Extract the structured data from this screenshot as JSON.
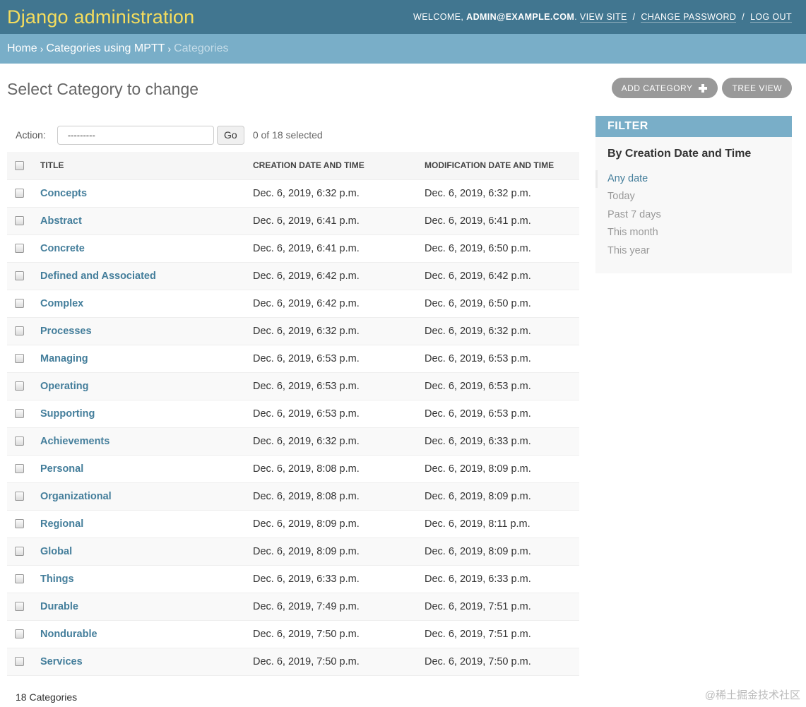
{
  "header": {
    "branding": "Django administration",
    "welcome": "WELCOME,",
    "user": "ADMIN@EXAMPLE.COM",
    "view_site": "VIEW SITE",
    "change_password": "CHANGE PASSWORD",
    "log_out": "LOG OUT"
  },
  "breadcrumbs": {
    "home": "Home",
    "app": "Categories using MPTT",
    "current": "Categories"
  },
  "page_title": "Select Category to change",
  "tools": {
    "add_label": "ADD CATEGORY",
    "tree_label": "TREE VIEW"
  },
  "actions": {
    "label": "Action:",
    "select_value": "---------",
    "go_label": "Go",
    "selected_text": "0 of 18 selected"
  },
  "table": {
    "headers": {
      "title": "TITLE",
      "created": "CREATION DATE AND TIME",
      "modified": "MODIFICATION DATE AND TIME"
    },
    "rows": [
      {
        "title": "Concepts",
        "created": "Dec. 6, 2019, 6:32 p.m.",
        "modified": "Dec. 6, 2019, 6:32 p.m."
      },
      {
        "title": "Abstract",
        "created": "Dec. 6, 2019, 6:41 p.m.",
        "modified": "Dec. 6, 2019, 6:41 p.m."
      },
      {
        "title": "Concrete",
        "created": "Dec. 6, 2019, 6:41 p.m.",
        "modified": "Dec. 6, 2019, 6:50 p.m."
      },
      {
        "title": "Defined and Associated",
        "created": "Dec. 6, 2019, 6:42 p.m.",
        "modified": "Dec. 6, 2019, 6:42 p.m."
      },
      {
        "title": "Complex",
        "created": "Dec. 6, 2019, 6:42 p.m.",
        "modified": "Dec. 6, 2019, 6:50 p.m."
      },
      {
        "title": "Processes",
        "created": "Dec. 6, 2019, 6:32 p.m.",
        "modified": "Dec. 6, 2019, 6:32 p.m."
      },
      {
        "title": "Managing",
        "created": "Dec. 6, 2019, 6:53 p.m.",
        "modified": "Dec. 6, 2019, 6:53 p.m."
      },
      {
        "title": "Operating",
        "created": "Dec. 6, 2019, 6:53 p.m.",
        "modified": "Dec. 6, 2019, 6:53 p.m."
      },
      {
        "title": "Supporting",
        "created": "Dec. 6, 2019, 6:53 p.m.",
        "modified": "Dec. 6, 2019, 6:53 p.m."
      },
      {
        "title": "Achievements",
        "created": "Dec. 6, 2019, 6:32 p.m.",
        "modified": "Dec. 6, 2019, 6:33 p.m."
      },
      {
        "title": "Personal",
        "created": "Dec. 6, 2019, 8:08 p.m.",
        "modified": "Dec. 6, 2019, 8:09 p.m."
      },
      {
        "title": "Organizational",
        "created": "Dec. 6, 2019, 8:08 p.m.",
        "modified": "Dec. 6, 2019, 8:09 p.m."
      },
      {
        "title": "Regional",
        "created": "Dec. 6, 2019, 8:09 p.m.",
        "modified": "Dec. 6, 2019, 8:11 p.m."
      },
      {
        "title": "Global",
        "created": "Dec. 6, 2019, 8:09 p.m.",
        "modified": "Dec. 6, 2019, 8:09 p.m."
      },
      {
        "title": "Things",
        "created": "Dec. 6, 2019, 6:33 p.m.",
        "modified": "Dec. 6, 2019, 6:33 p.m."
      },
      {
        "title": "Durable",
        "created": "Dec. 6, 2019, 7:49 p.m.",
        "modified": "Dec. 6, 2019, 7:51 p.m."
      },
      {
        "title": "Nondurable",
        "created": "Dec. 6, 2019, 7:50 p.m.",
        "modified": "Dec. 6, 2019, 7:51 p.m."
      },
      {
        "title": "Services",
        "created": "Dec. 6, 2019, 7:50 p.m.",
        "modified": "Dec. 6, 2019, 7:50 p.m."
      }
    ]
  },
  "footer_count": "18 Categories",
  "filter": {
    "heading": "FILTER",
    "subheading": "By Creation Date and Time",
    "options": [
      "Any date",
      "Today",
      "Past 7 days",
      "This month",
      "This year"
    ]
  },
  "watermark": "@稀土掘金技术社区",
  "colors": {
    "header_bg": "#417690",
    "branding": "#f5dd5d",
    "breadcrumb_bg": "#79aec8",
    "link": "#447e9b",
    "button_bg": "#999999"
  }
}
